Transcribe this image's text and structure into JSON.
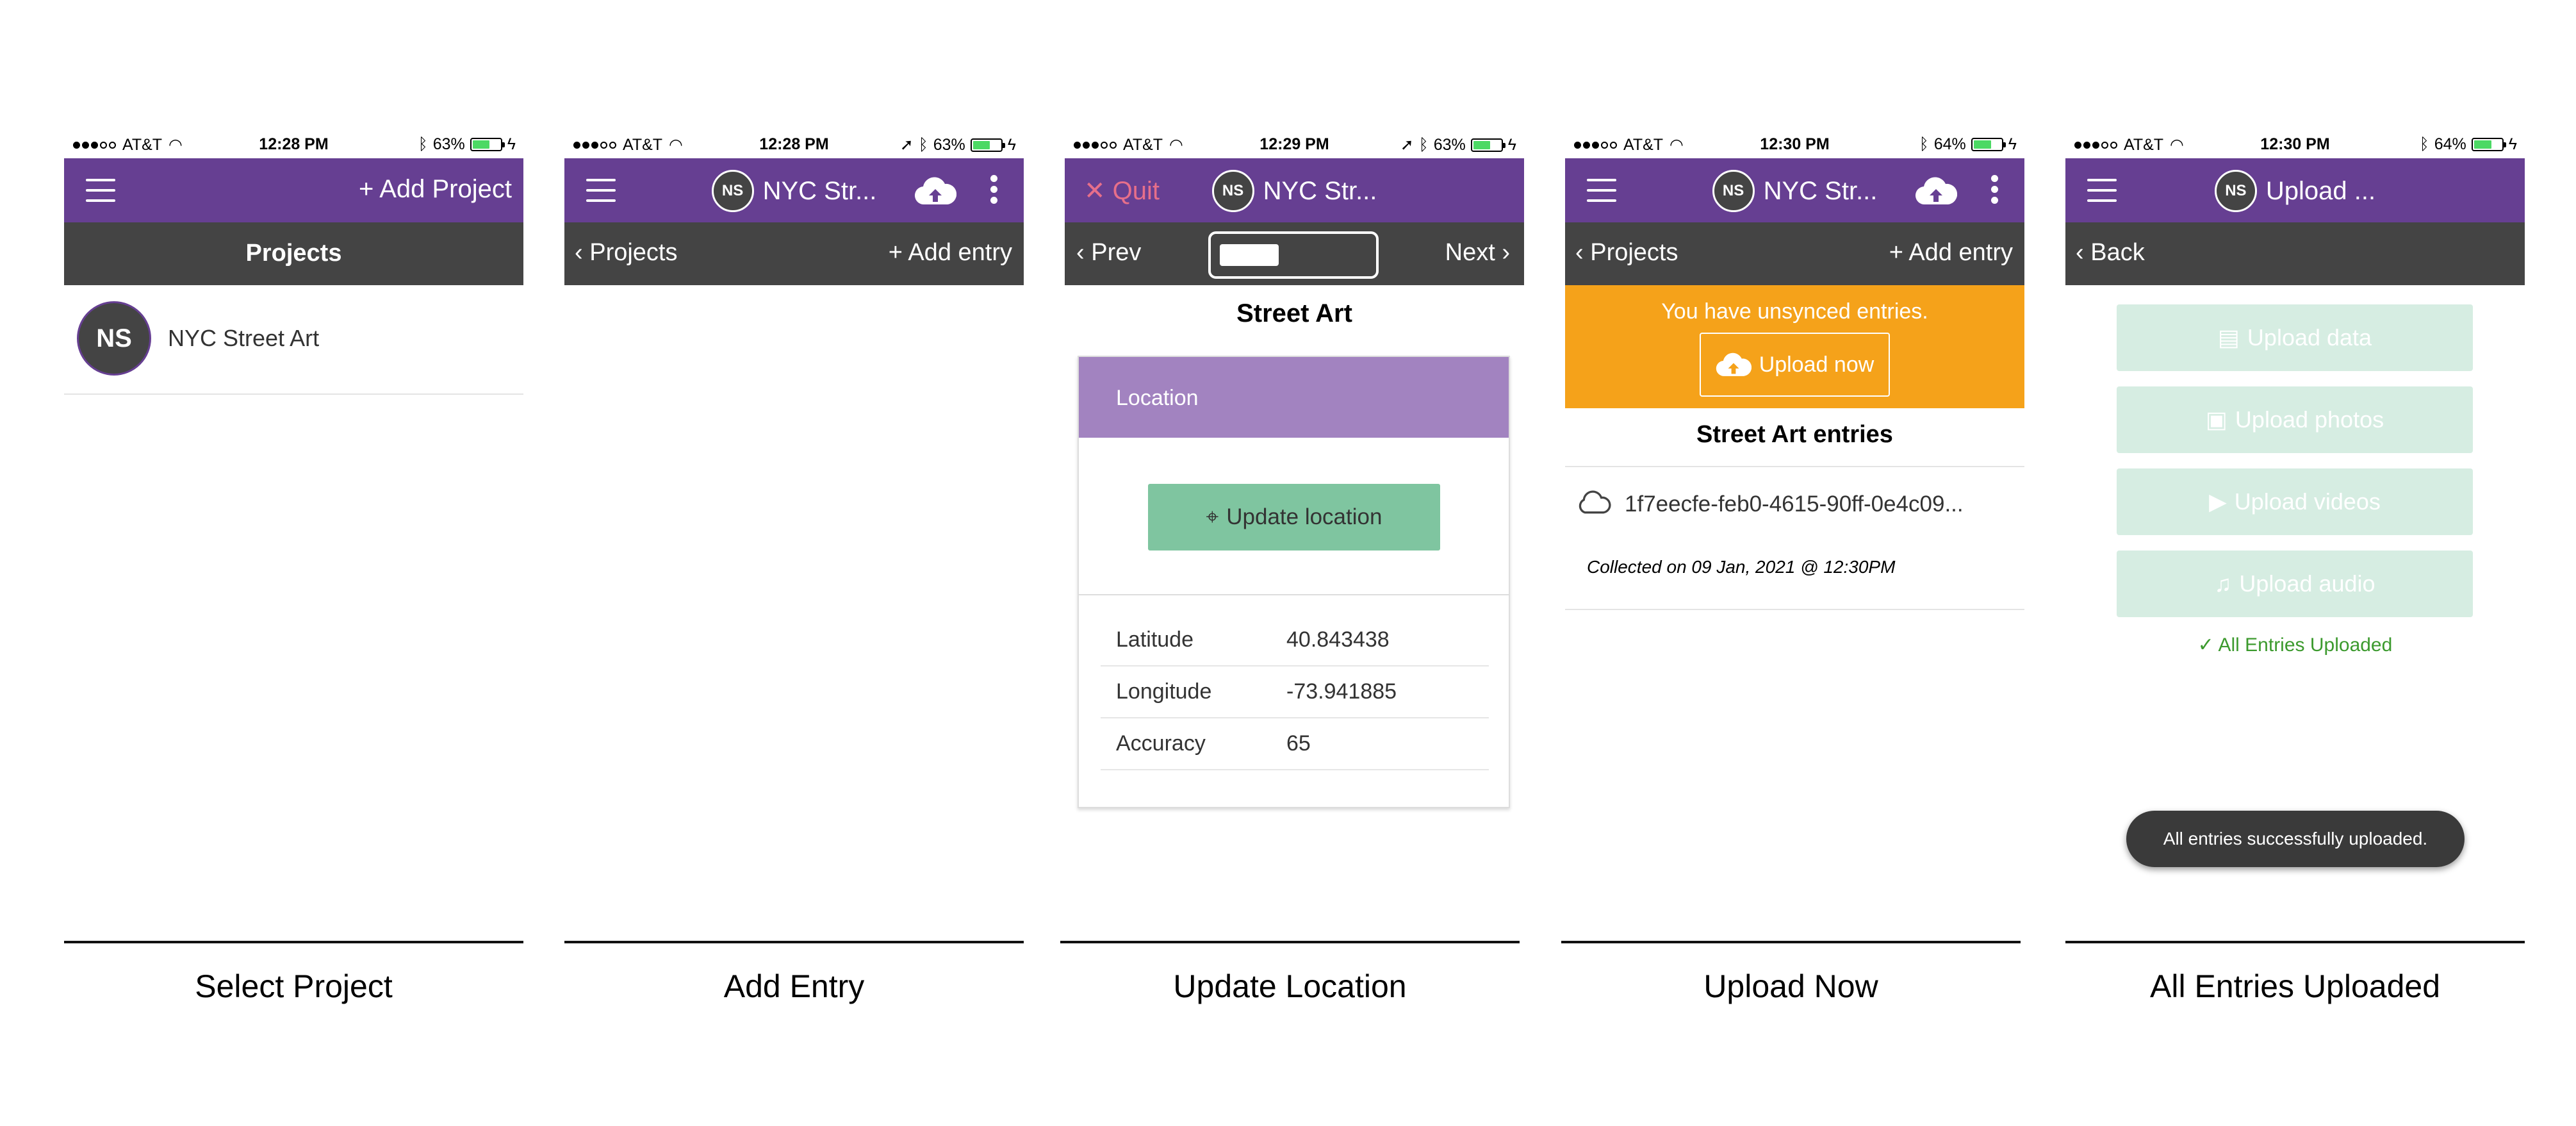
{
  "status": {
    "carrier": "AT&T",
    "s1_time": "12:28 PM",
    "s1_batt": "63%",
    "s2_time": "12:28 PM",
    "s2_batt": "63%",
    "s3_time": "12:29 PM",
    "s3_batt": "63%",
    "s4_time": "12:30 PM",
    "s4_batt": "64%",
    "s5_time": "12:30 PM",
    "s5_batt": "64%"
  },
  "colors": {
    "purple": "#663f92",
    "dark": "#444444",
    "orange": "#f5a21a",
    "green": "#5cb585"
  },
  "screen1": {
    "add_project": "+ Add Project",
    "sub_title": "Projects",
    "project": {
      "initials": "NS",
      "name": "NYC Street Art"
    }
  },
  "screen2": {
    "initials": "NS",
    "title": "NYC Str...",
    "back": "Projects",
    "add_entry": "+ Add entry"
  },
  "screen3": {
    "quit": "Quit",
    "initials": "NS",
    "title": "NYC Str...",
    "prev": "Prev",
    "next": "Next",
    "form_title": "Street Art",
    "card_header": "Location",
    "update_btn": "Update location",
    "rows": [
      {
        "label": "Latitude",
        "value": "40.843438"
      },
      {
        "label": "Longitude",
        "value": "-73.941885"
      },
      {
        "label": "Accuracy",
        "value": "65"
      }
    ]
  },
  "screen4": {
    "initials": "NS",
    "title": "NYC Str...",
    "back": "Projects",
    "add_entry": "+ Add entry",
    "banner": "You have unsynced entries.",
    "upload_now": "Upload now",
    "list_title": "Street Art entries",
    "entry_id": "1f7eecfe-feb0-4615-90ff-0e4c09...",
    "entry_date": "Collected on 09 Jan, 2021 @ 12:30PM"
  },
  "screen5": {
    "initials": "NS",
    "title": "Upload ...",
    "back": "Back",
    "buttons": [
      "Upload data",
      "Upload photos",
      "Upload videos",
      "Upload audio"
    ],
    "status": "✓ All Entries Uploaded",
    "toast": "All entries successfully uploaded."
  },
  "captions": [
    "Select Project",
    "Add Entry",
    "Update Location",
    "Upload Now",
    "All Entries Uploaded"
  ]
}
